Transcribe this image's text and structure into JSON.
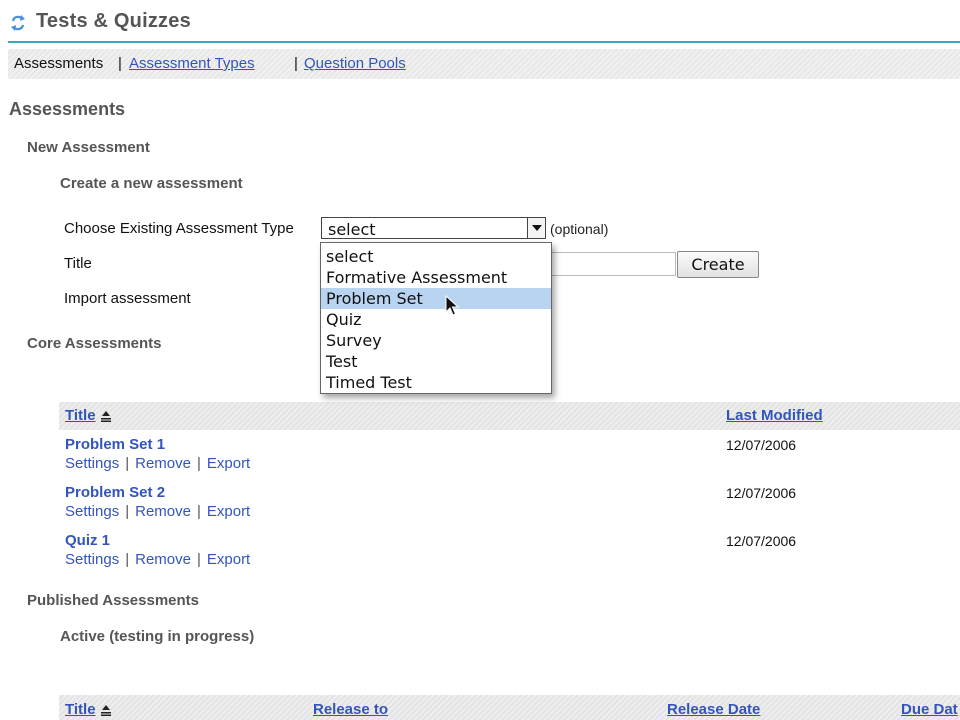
{
  "header": {
    "title": "Tests & Quizzes",
    "icon": "refresh-arrows-icon",
    "rule_color": "#3aa8b8"
  },
  "nav": {
    "current": "Assessments",
    "separator": "|",
    "links": [
      "Assessment Types",
      "Question Pools"
    ]
  },
  "main": {
    "section_title": "Assessments",
    "new_assessment": {
      "heading": "New Assessment",
      "subheading": "Create a new assessment",
      "type_label": "Choose Existing Assessment Type",
      "type_value": "select",
      "optional_note": "(optional)",
      "title_label": "Title",
      "title_value": "",
      "import_label": "Import assessment",
      "create_button": "Create",
      "dropdown_options": [
        "select",
        "Formative Assessment",
        "Problem Set",
        "Quiz",
        "Survey",
        "Test",
        "Timed Test"
      ],
      "highlighted_option": "Problem Set"
    },
    "core": {
      "heading": "Core Assessments",
      "columns": {
        "title": "Title",
        "last_modified": "Last Modified"
      },
      "rows": [
        {
          "title": "Problem Set 1",
          "date": "12/07/2006"
        },
        {
          "title": "Problem Set 2",
          "date": "12/07/2006"
        },
        {
          "title": "Quiz 1",
          "date": "12/07/2006"
        }
      ],
      "actions": [
        "Settings",
        "Remove",
        "Export"
      ]
    },
    "published": {
      "heading": "Published Assessments",
      "active_heading": "Active (testing in progress)",
      "columns": {
        "title": "Title",
        "release_to": "Release to",
        "release_date": "Release Date",
        "due_date": "Due Dat"
      }
    }
  },
  "colors": {
    "link": "#3355bb",
    "highlight": "#b9d4f0",
    "heading_gray": "#555555"
  }
}
